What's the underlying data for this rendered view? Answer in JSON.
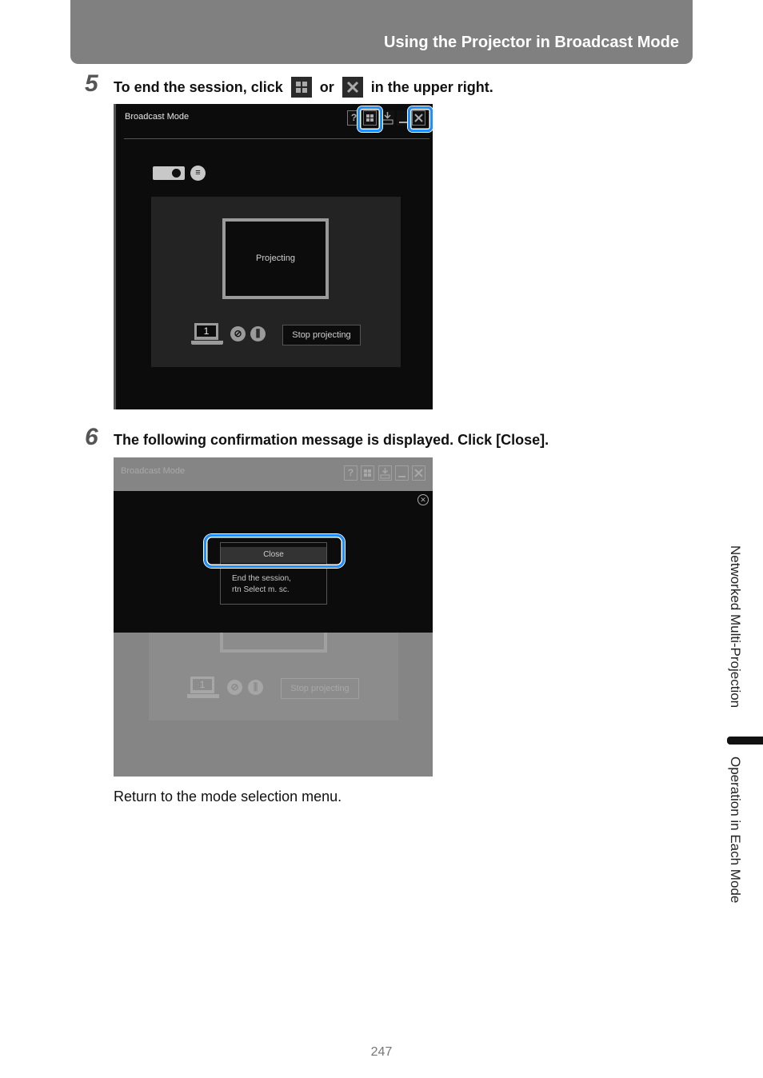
{
  "header": {
    "title": "Using the Projector in Broadcast Mode"
  },
  "steps": [
    {
      "number": "5",
      "text_before": "To end the session, click",
      "icon1": "mode-menu-icon",
      "text_mid": "or",
      "icon2": "close-icon",
      "text_after": "in the upper right."
    },
    {
      "number": "6",
      "text": "The following confirmation message is displayed. Click [Close]."
    }
  ],
  "screenshot1": {
    "window_title": "Broadcast Mode",
    "toolbar": [
      {
        "icon": "help-icon",
        "glyph": "?"
      },
      {
        "icon": "mode-menu-icon",
        "glyph": "▪▪",
        "highlighted": true
      },
      {
        "icon": "download-icon",
        "glyph": "↓"
      },
      {
        "icon": "minimize-icon",
        "glyph": "_"
      },
      {
        "icon": "close-icon",
        "glyph": "✕",
        "highlighted": true
      }
    ],
    "screen_label": "Projecting",
    "pc_number": "1",
    "stop_button": "Stop projecting"
  },
  "screenshot2": {
    "window_title": "Broadcast Mode",
    "dialog_close_glyph": "✕",
    "menu_close_label": "Close",
    "menu_desc_line1": "End the session,",
    "menu_desc_line2": "rtn Select m. sc.",
    "pc_number": "1",
    "stop_button": "Stop projecting"
  },
  "body_text": "Return to the mode selection menu.",
  "side_tabs": {
    "section": "Networked Multi-Projection",
    "subsection": "Operation in Each Mode"
  },
  "page_number": "247"
}
